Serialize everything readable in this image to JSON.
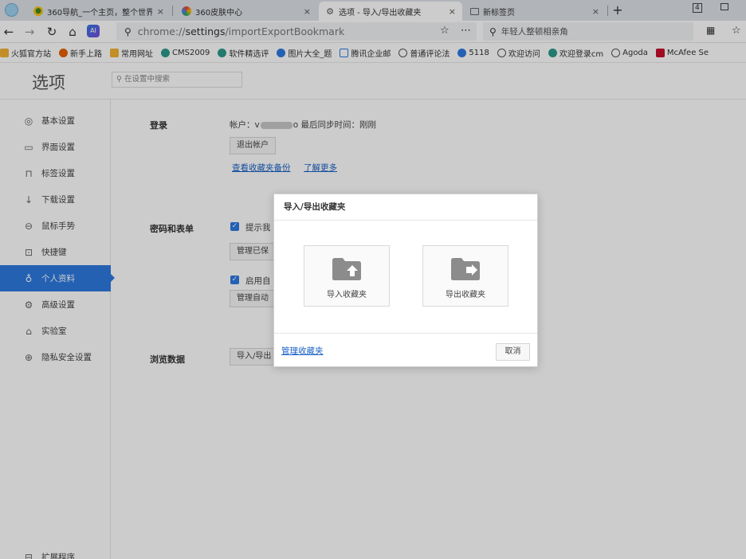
{
  "tabs": [
    {
      "title": "360导航_一个主页，整个世界",
      "icon": "360-logo-icon"
    },
    {
      "title": "360皮肤中心",
      "icon": "360-skin-icon"
    },
    {
      "title": "选项 - 导入/导出收藏夹",
      "icon": "gear-icon",
      "active": true
    },
    {
      "title": "新标签页",
      "icon": "newtab-icon"
    }
  ],
  "window": {
    "badge": "4"
  },
  "address": {
    "scheme": "chrome://",
    "host": "settings",
    "path": "/importExportBookmark"
  },
  "search": {
    "placeholder": "年轻人整顿相亲角"
  },
  "bookmarks": [
    "火狐官方站",
    "新手上路",
    "常用网址",
    "CMS2009",
    "软件精选评",
    "图片大全_题",
    "腾讯企业邮",
    "普通评论法",
    "5118",
    "欢迎访问",
    "欢迎登录cm",
    "Agoda",
    "McAfee Se"
  ],
  "page": {
    "title": "选项",
    "search_placeholder": "在设置中搜索",
    "sidebar": [
      {
        "label": "基本设置",
        "icon": "settings-circle-icon"
      },
      {
        "label": "界面设置",
        "icon": "window-icon"
      },
      {
        "label": "标签设置",
        "icon": "tab-icon"
      },
      {
        "label": "下载设置",
        "icon": "download-icon"
      },
      {
        "label": "鼠标手势",
        "icon": "mouse-icon"
      },
      {
        "label": "快捷键",
        "icon": "keyboard-icon"
      },
      {
        "label": "个人资料",
        "icon": "user-icon",
        "active": true
      },
      {
        "label": "高级设置",
        "icon": "advanced-icon"
      },
      {
        "label": "实验室",
        "icon": "lab-icon"
      },
      {
        "label": "隐私安全设置",
        "icon": "shield-icon"
      }
    ],
    "sidebar_bottom": "扩展程序",
    "login": {
      "section": "登录",
      "account_label": "帐户：",
      "account_end": "o",
      "sync_text": "最后同步时间：刚刚",
      "logout": "退出帐户",
      "view_backup": "查看收藏夹备份",
      "learn_more": "了解更多"
    },
    "password": {
      "section": "密码和表单",
      "option1": "提示我",
      "manage1": "管理已保",
      "option2": "启用自",
      "manage2": "管理自动"
    },
    "browse": {
      "section": "浏览数据",
      "button": "导入/导出"
    }
  },
  "dialog": {
    "title": "导入/导出收藏夹",
    "import_label": "导入收藏夹",
    "export_label": "导出收藏夹",
    "manage_link": "管理收藏夹",
    "cancel": "取消"
  },
  "colors": {
    "accent": "#2e7ae0",
    "link": "#1a62c7"
  }
}
